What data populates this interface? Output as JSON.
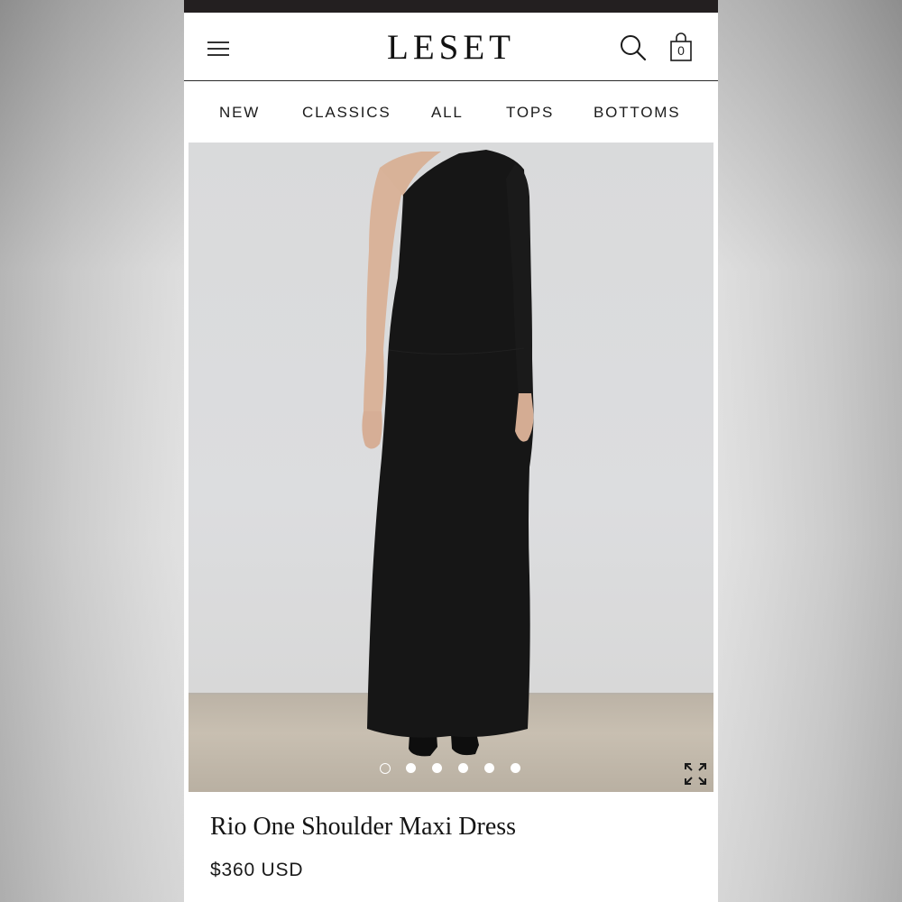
{
  "header": {
    "logo": "LESET",
    "cart_count": "0"
  },
  "nav": {
    "items": [
      "NEW",
      "CLASSICS",
      "ALL",
      "TOPS",
      "BOTTOMS"
    ]
  },
  "product": {
    "title": "Rio One Shoulder Maxi Dress",
    "price": "$360 USD",
    "image_count": 6,
    "active_image": 1
  },
  "colors": {
    "topbar": "#231f20",
    "dress": "#161616",
    "wall": "#dcdddf",
    "floor": "#c3baad"
  },
  "icons": [
    "hamburger-menu-icon",
    "search-icon",
    "shopping-bag-icon",
    "expand-icon"
  ]
}
